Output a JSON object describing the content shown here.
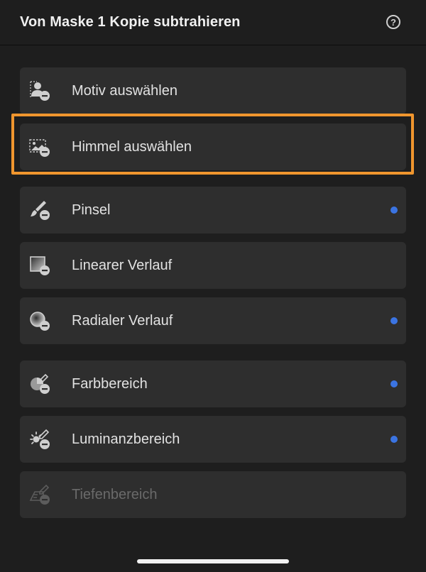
{
  "header": {
    "title": "Von Maske 1 Kopie subtrahieren",
    "help_symbol": "?"
  },
  "colors": {
    "highlight": "#f0962e",
    "indicator_dot": "#3b74e2",
    "item_background": "#2e2e2e",
    "panel_background": "#1e1e1e"
  },
  "items": [
    {
      "label": "Motiv auswählen",
      "icon": "select-subject-icon",
      "has_dot": false,
      "disabled": false,
      "highlighted": false
    },
    {
      "label": "Himmel auswählen",
      "icon": "select-sky-icon",
      "has_dot": false,
      "disabled": false,
      "highlighted": true
    },
    {
      "label": "Pinsel",
      "icon": "brush-icon",
      "has_dot": true,
      "disabled": false,
      "highlighted": false
    },
    {
      "label": "Linearer Verlauf",
      "icon": "linear-gradient-icon",
      "has_dot": false,
      "disabled": false,
      "highlighted": false
    },
    {
      "label": "Radialer Verlauf",
      "icon": "radial-gradient-icon",
      "has_dot": true,
      "disabled": false,
      "highlighted": false
    },
    {
      "label": "Farbbereich",
      "icon": "color-range-icon",
      "has_dot": true,
      "disabled": false,
      "highlighted": false
    },
    {
      "label": "Luminanzbereich",
      "icon": "luminance-range-icon",
      "has_dot": true,
      "disabled": false,
      "highlighted": false
    },
    {
      "label": "Tiefenbereich",
      "icon": "depth-range-icon",
      "has_dot": false,
      "disabled": true,
      "highlighted": false
    }
  ]
}
